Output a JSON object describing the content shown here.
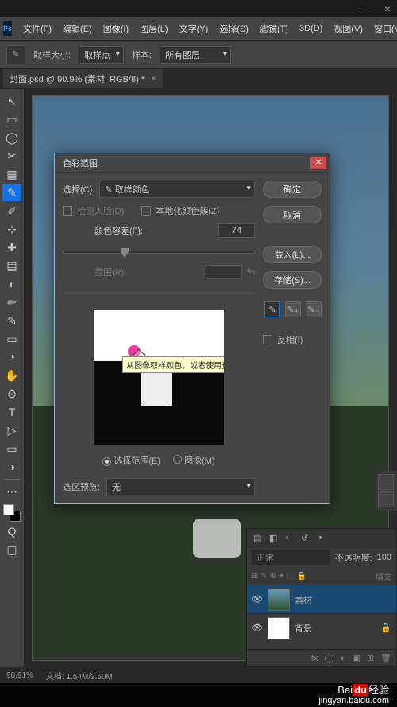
{
  "window_controls": {
    "min": "—",
    "close": "×"
  },
  "menu": [
    "文件(F)",
    "编辑(E)",
    "图像(I)",
    "图层(L)",
    "文字(Y)",
    "选择(S)",
    "滤镜(T)",
    "3D(D)",
    "视图(V)",
    "窗口(V"
  ],
  "options": {
    "sample_size_label": "取样大小:",
    "sample_size_value": "取样点",
    "sample_label": "样本:",
    "sample_value": "所有图层"
  },
  "doc_tab": {
    "title": "封面.psd @ 90.9% (素材, RGB/8) *",
    "close": "×"
  },
  "tools": [
    "↖",
    "▭",
    "◯",
    "✂",
    "▦",
    "✎",
    "✐",
    "⊹",
    "✚",
    "▤",
    "◐",
    "✏",
    "✎",
    "▭",
    "◔",
    "✋",
    "⊙",
    "T",
    "▷",
    "▭",
    "◑",
    "⬚",
    "Q"
  ],
  "dialog": {
    "title": "色彩范围",
    "select_label": "选择(C):",
    "select_value": "✎ 取样颜色",
    "detect_faces": "检测人脸(D)",
    "localized": "本地化颜色簇(Z)",
    "fuzziness_label": "颜色容差(F):",
    "fuzziness_value": "74",
    "range_label": "范围(R):",
    "range_pct": "%",
    "tooltip": "从图像取样颜色，或者使用预定义的颜色范围",
    "radio_selection": "选择范围(E)",
    "radio_image": "图像(M)",
    "preview_label": "选区预览:",
    "preview_value": "无",
    "invert": "反相(I)",
    "buttons": {
      "ok": "确定",
      "cancel": "取消",
      "load": "载入(L)...",
      "save": "存储(S)..."
    }
  },
  "layers": {
    "blend": "正常",
    "opacity_label": "不透明度:",
    "opacity_value": "100",
    "lock_label": "锁",
    "fill_label": "填充",
    "items": [
      {
        "name": "素材",
        "selected": true
      },
      {
        "name": "背景",
        "selected": false
      }
    ]
  },
  "status": {
    "zoom": "90.91%",
    "docinfo": "文档: 1.54M/2.50M"
  },
  "watermark": {
    "brand_a": "Bai",
    "brand_b": "du",
    "brand_c": "经验",
    "url": "jingyan.baidu.com"
  }
}
